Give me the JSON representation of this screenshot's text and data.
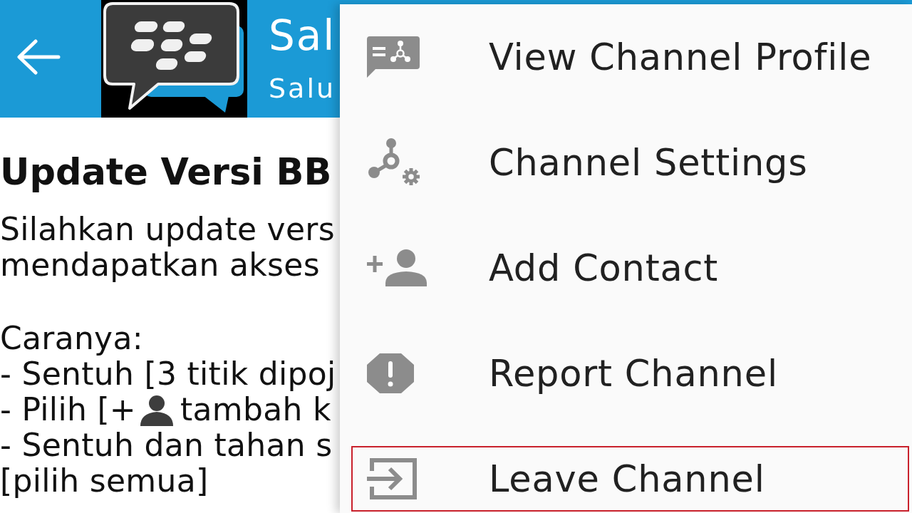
{
  "header": {
    "title": "Sal",
    "subtitle": "Salu"
  },
  "post": {
    "title": "Update Versi BB",
    "paragraphs": [
      {
        "lines": [
          {
            "kind": "text",
            "text": "Silahkan update vers"
          },
          {
            "kind": "text",
            "text": "mendapatkan akses"
          }
        ]
      },
      {
        "lines": [
          {
            "kind": "text",
            "text": "Caranya:"
          },
          {
            "kind": "text",
            "text": "- Sentuh [3 titik dipoj"
          },
          {
            "kind": "icon_text",
            "before": "- Pilih [+",
            "after": "tambah k"
          },
          {
            "kind": "text",
            "text": "- Sentuh dan tahan s"
          },
          {
            "kind": "text",
            "text": "[pilih semua]"
          }
        ]
      }
    ]
  },
  "menu": {
    "items": [
      {
        "label": "View Channel Profile",
        "highlighted": false
      },
      {
        "label": "Channel Settings",
        "highlighted": false
      },
      {
        "label": "Add Contact",
        "highlighted": false
      },
      {
        "label": "Report Channel",
        "highlighted": false
      },
      {
        "label": "Leave Channel",
        "highlighted": true
      }
    ]
  }
}
